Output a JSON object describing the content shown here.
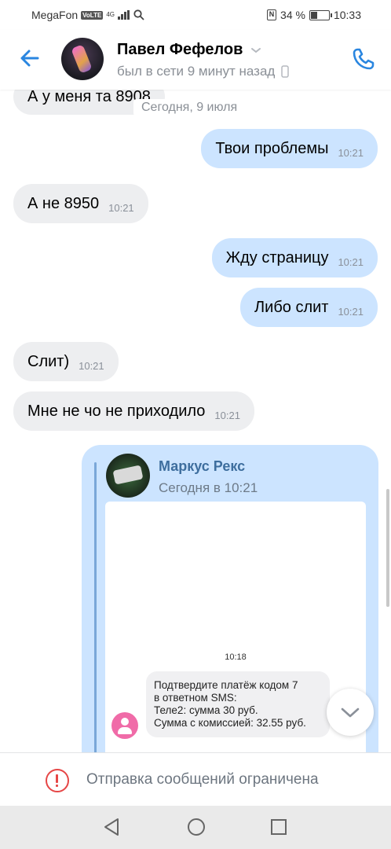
{
  "status_bar": {
    "carrier": "MegaFon",
    "volte": "VoLTE",
    "network": "4G",
    "battery_text": "34 %",
    "battery_level": 0.34,
    "time": "10:33"
  },
  "header": {
    "name": "Павел Фефелов",
    "status": "был в сети 9 минут назад"
  },
  "chat": {
    "partial_message": "А у меня та 8908",
    "date_separator": "Сегодня, 9 июля",
    "messages": [
      {
        "text": "Твои проблемы",
        "time": "10:21",
        "direction": "out"
      },
      {
        "text": "А не 8950",
        "time": "10:21",
        "direction": "in"
      },
      {
        "text": "Жду страницу",
        "time": "10:21",
        "direction": "out"
      },
      {
        "text": "Либо слит",
        "time": "10:21",
        "direction": "out"
      },
      {
        "text": "Слит)",
        "time": "10:21",
        "direction": "in"
      },
      {
        "text": "Мне не чо не приходило",
        "time": "10:21",
        "direction": "in"
      }
    ],
    "forwarded": {
      "author": "Маркус Рекс",
      "time": "Сегодня в 10:21",
      "screenshot": {
        "time": "10:18",
        "sms_lines": [
          "Подтвердите платёж кодом 7",
          "в ответном SMS:",
          "Теле2: сумма 30 руб.",
          "Сумма с комиссией: 32.55 руб."
        ]
      }
    }
  },
  "restriction": {
    "text": "Отправка сообщений ограничена"
  },
  "colors": {
    "accent": "#2a86e0",
    "incoming_bubble": "#edeef0",
    "outgoing_bubble": "#cce4ff",
    "warning": "#e64646"
  },
  "icons": [
    "back-arrow-icon",
    "chevron-down-icon",
    "phone-icon",
    "call-icon",
    "chevron-down-icon",
    "alert-icon",
    "nav-back-icon",
    "nav-home-icon",
    "nav-recent-icon"
  ]
}
